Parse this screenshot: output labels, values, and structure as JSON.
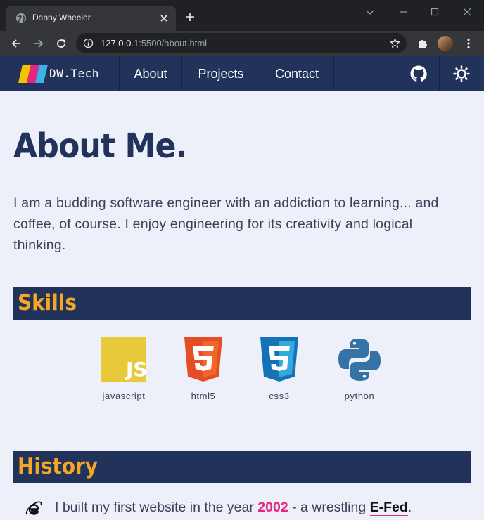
{
  "browser": {
    "tab_title": "Danny Wheeler",
    "url_host": "127.0.0.1",
    "url_path": ":5500/about.html"
  },
  "nav": {
    "brand": "DW.Tech",
    "links": [
      "About",
      "Projects",
      "Contact"
    ]
  },
  "about": {
    "title": "About Me.",
    "intro": "I am a budding software engineer with an addiction to learning... and coffee, of course. I enjoy engineering for its creativity and logical thinking."
  },
  "skills": {
    "heading": "Skills",
    "items": [
      "javascript",
      "html5",
      "css3",
      "python"
    ]
  },
  "history": {
    "heading": "History",
    "text_before": "I built my first website in the year ",
    "year": "2002",
    "text_middle": " - a wrestling ",
    "link": "E-Fed",
    "text_after": "."
  },
  "colors": {
    "nav_bg": "#21335a",
    "page_bg": "#edf0f9",
    "accent_orange": "#f5a623",
    "accent_pink": "#e5257f"
  }
}
